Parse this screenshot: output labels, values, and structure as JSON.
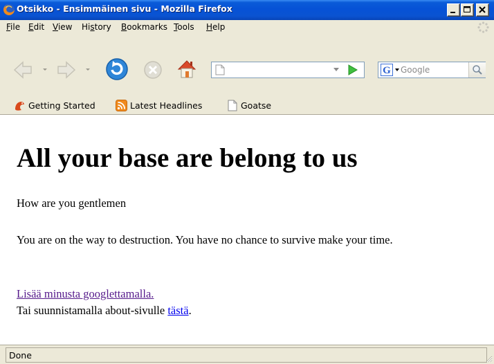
{
  "window": {
    "title": "Otsikko - Ensimmäinen sivu - Mozilla Firefox"
  },
  "menu": {
    "items": [
      {
        "label": "File",
        "accesskey": "F"
      },
      {
        "label": "Edit",
        "accesskey": "E"
      },
      {
        "label": "View",
        "accesskey": "V"
      },
      {
        "label": "History",
        "accesskey": "s"
      },
      {
        "label": "Bookmarks",
        "accesskey": "B"
      },
      {
        "label": "Tools",
        "accesskey": "T"
      },
      {
        "label": "Help",
        "accesskey": "H"
      }
    ]
  },
  "toolbar": {
    "url_value": "",
    "search_placeholder": "Google"
  },
  "bookmarks": [
    {
      "label": "Getting Started",
      "icon": "firefox-mascot-icon"
    },
    {
      "label": "Latest Headlines",
      "icon": "rss-feed-icon"
    },
    {
      "label": "Goatse",
      "icon": "page-icon"
    }
  ],
  "page": {
    "heading": "All your base are belong to us",
    "p1": "How are you gentlemen",
    "p2": "You are on the way to destruction. You have no chance to survive make your time.",
    "link_google": "Lisää minusta googlettamalla.",
    "about_text": "Tai suunnistamalla about-sivulle ",
    "link_here": "tästä",
    "period": "."
  },
  "status": {
    "text": "Done"
  },
  "colors": {
    "titlebar": "#0a53d1",
    "link": "#0000ee",
    "visited_link": "#551a8b",
    "chrome": "#ece9d8"
  }
}
